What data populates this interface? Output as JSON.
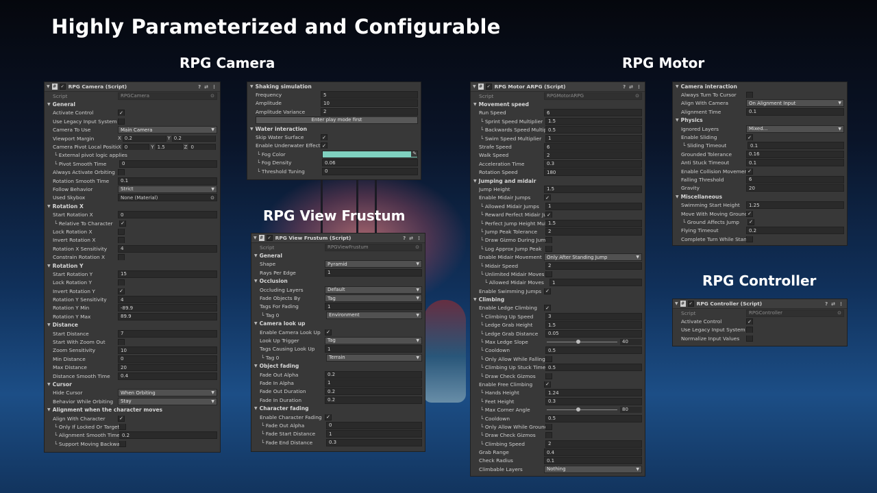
{
  "headline": "Highly Parameterized and Configurable",
  "section_titles": {
    "camera": "RPG Camera",
    "motor": "RPG Motor",
    "frustum": "RPG View Frustum",
    "controller": "RPG Controller"
  },
  "header_icons": [
    "help-icon",
    "settings-icon",
    "more-icon"
  ],
  "colors": {
    "panel": "#383838",
    "field": "#2a2a2a",
    "fog_color": "#7fd0bf"
  },
  "camera_panel": {
    "header": "RPG Camera (Script)",
    "rows": [
      {
        "t": "script",
        "label": "Script",
        "value": "RPGCamera"
      },
      {
        "t": "group",
        "label": "General"
      },
      {
        "t": "check",
        "label": "Activate Control",
        "value": true
      },
      {
        "t": "check",
        "label": "Use Legacy Input System",
        "value": false
      },
      {
        "t": "dropdown",
        "label": "Camera To Use",
        "value": "Main Camera"
      },
      {
        "t": "vec",
        "label": "Viewport Margin",
        "axes": [
          "X",
          "Y"
        ],
        "values": [
          "0.2",
          "0.2"
        ]
      },
      {
        "t": "vec",
        "label": "Camera Pivot Local Position",
        "axes": [
          "X",
          "Y",
          "Z"
        ],
        "values": [
          "0",
          "1.5",
          "0"
        ]
      },
      {
        "t": "note",
        "label": "└ External pivot logic applies"
      },
      {
        "t": "field",
        "label": "Pivot Smooth Time",
        "value": "0",
        "sub": 1
      },
      {
        "t": "check",
        "label": "Always Activate Orbiting",
        "value": false
      },
      {
        "t": "field",
        "label": "Rotation Smooth Time",
        "value": "0.1"
      },
      {
        "t": "dropdown",
        "label": "Follow Behavior",
        "value": "Strict"
      },
      {
        "t": "object",
        "label": "Used Skybox",
        "value": "None (Material)"
      },
      {
        "t": "group",
        "label": "Rotation X"
      },
      {
        "t": "field",
        "label": "Start Rotation X",
        "value": "0"
      },
      {
        "t": "check",
        "label": "Relative To Character",
        "value": true,
        "sub": 1
      },
      {
        "t": "check",
        "label": "Lock Rotation X",
        "value": false
      },
      {
        "t": "check",
        "label": "Invert Rotation X",
        "value": false
      },
      {
        "t": "field",
        "label": "Rotation X Sensitivity",
        "value": "4"
      },
      {
        "t": "check",
        "label": "Constrain Rotation X",
        "value": false
      },
      {
        "t": "group",
        "label": "Rotation Y"
      },
      {
        "t": "field",
        "label": "Start Rotation Y",
        "value": "15"
      },
      {
        "t": "check",
        "label": "Lock Rotation Y",
        "value": false
      },
      {
        "t": "check",
        "label": "Invert Rotation Y",
        "value": true
      },
      {
        "t": "field",
        "label": "Rotation Y Sensitivity",
        "value": "4"
      },
      {
        "t": "field",
        "label": "Rotation Y Min",
        "value": "-89.9"
      },
      {
        "t": "field",
        "label": "Rotation Y Max",
        "value": "89.9"
      },
      {
        "t": "group",
        "label": "Distance"
      },
      {
        "t": "field",
        "label": "Start Distance",
        "value": "7"
      },
      {
        "t": "check",
        "label": "Start With Zoom Out",
        "value": false
      },
      {
        "t": "field",
        "label": "Zoom Sensitivity",
        "value": "10"
      },
      {
        "t": "field",
        "label": "Min Distance",
        "value": "0"
      },
      {
        "t": "field",
        "label": "Max Distance",
        "value": "20"
      },
      {
        "t": "field",
        "label": "Distance Smooth Time",
        "value": "0.4"
      },
      {
        "t": "group",
        "label": "Cursor"
      },
      {
        "t": "dropdown",
        "label": "Hide Cursor",
        "value": "When Orbiting"
      },
      {
        "t": "dropdown",
        "label": "Behavior While Orbiting",
        "value": "Stay"
      },
      {
        "t": "group",
        "label": "Alignment when the character moves"
      },
      {
        "t": "check",
        "label": "Align With Character",
        "value": true
      },
      {
        "t": "check",
        "label": "Only If Locked Or Targeting",
        "value": false,
        "sub": 1
      },
      {
        "t": "field",
        "label": "Alignment Smooth Time",
        "value": "0.2",
        "sub": 1
      },
      {
        "t": "check",
        "label": "Support Moving Backwards",
        "value": false,
        "sub": 1
      }
    ]
  },
  "shaking_panel": {
    "rows": [
      {
        "t": "group",
        "label": "Shaking simulation"
      },
      {
        "t": "field",
        "label": "Frequency",
        "value": "5"
      },
      {
        "t": "field",
        "label": "Amplitude",
        "value": "10"
      },
      {
        "t": "field",
        "label": "Amplitude Variance",
        "value": "2"
      },
      {
        "t": "button",
        "label": "Enter play mode first"
      },
      {
        "t": "group",
        "label": "Water interaction"
      },
      {
        "t": "check",
        "label": "Skip Water Surface",
        "value": true
      },
      {
        "t": "check",
        "label": "Enable Underwater Effect",
        "value": true
      },
      {
        "t": "color",
        "label": "Fog Color",
        "sub": 1
      },
      {
        "t": "field",
        "label": "Fog Density",
        "value": "0.06",
        "sub": 1
      },
      {
        "t": "field",
        "label": "Threshold Tuning",
        "value": "0",
        "sub": 1
      }
    ]
  },
  "frustum_panel": {
    "header": "RPG View Frustum (Script)",
    "rows": [
      {
        "t": "script",
        "label": "Script",
        "value": "RPGViewFrustum"
      },
      {
        "t": "group",
        "label": "General"
      },
      {
        "t": "dropdown",
        "label": "Shape",
        "value": "Pyramid"
      },
      {
        "t": "field",
        "label": "Rays Per Edge",
        "value": "1"
      },
      {
        "t": "group",
        "label": "Occlusion"
      },
      {
        "t": "dropdown",
        "label": "Occluding Layers",
        "value": "Default"
      },
      {
        "t": "dropdown",
        "label": "Fade Objects By",
        "value": "Tag"
      },
      {
        "t": "field",
        "label": "Tags For Fading",
        "value": "1"
      },
      {
        "t": "dropdown",
        "label": "Tag 0",
        "value": "Environment",
        "sub": 1
      },
      {
        "t": "group",
        "label": "Camera look up"
      },
      {
        "t": "check",
        "label": "Enable Camera Look Up",
        "value": true
      },
      {
        "t": "dropdown",
        "label": "Look Up Trigger",
        "value": "Tag"
      },
      {
        "t": "field",
        "label": "Tags Causing Look Up",
        "value": "1"
      },
      {
        "t": "dropdown",
        "label": "Tag 0",
        "value": "Terrain",
        "sub": 1
      },
      {
        "t": "group",
        "label": "Object fading"
      },
      {
        "t": "field",
        "label": "Fade Out Alpha",
        "value": "0.2"
      },
      {
        "t": "field",
        "label": "Fade In Alpha",
        "value": "1"
      },
      {
        "t": "field",
        "label": "Fade Out Duration",
        "value": "0.2"
      },
      {
        "t": "field",
        "label": "Fade In Duration",
        "value": "0.2"
      },
      {
        "t": "group",
        "label": "Character fading"
      },
      {
        "t": "check",
        "label": "Enable Character Fading",
        "value": true
      },
      {
        "t": "field",
        "label": "Fade Out Alpha",
        "value": "0",
        "sub": 1
      },
      {
        "t": "field",
        "label": "Fade Start Distance",
        "value": "1",
        "sub": 1
      },
      {
        "t": "field",
        "label": "Fade End Distance",
        "value": "0.3",
        "sub": 1
      }
    ]
  },
  "motor_panel": {
    "header": "RPG Motor ARPG (Script)",
    "rows": [
      {
        "t": "script",
        "label": "Script",
        "value": "RPGMotorARPG"
      },
      {
        "t": "group",
        "label": "Movement speed"
      },
      {
        "t": "field",
        "label": "Run Speed",
        "value": "6"
      },
      {
        "t": "field",
        "label": "Sprint Speed Multiplier",
        "value": "1.5",
        "sub": 1
      },
      {
        "t": "field",
        "label": "Backwards Speed Multiplier",
        "value": "0.5",
        "sub": 1
      },
      {
        "t": "field",
        "label": "Swim Speed Multiplier",
        "value": "1",
        "sub": 1
      },
      {
        "t": "field",
        "label": "Strafe Speed",
        "value": "6"
      },
      {
        "t": "field",
        "label": "Walk Speed",
        "value": "2"
      },
      {
        "t": "field",
        "label": "Acceleration Time",
        "value": "0.3"
      },
      {
        "t": "field",
        "label": "Rotation Speed",
        "value": "180"
      },
      {
        "t": "group",
        "label": "Jumping and midair"
      },
      {
        "t": "field",
        "label": "Jump Height",
        "value": "1.5"
      },
      {
        "t": "check",
        "label": "Enable Midair Jumps",
        "value": true
      },
      {
        "t": "field",
        "label": "Allowed Midair Jumps",
        "value": "1",
        "sub": 1
      },
      {
        "t": "check",
        "label": "Reward Perfect Midair Jumps",
        "value": true,
        "sub": 1
      },
      {
        "t": "field",
        "label": "Perfect Jump Height Multiplier",
        "value": "1.5",
        "sub": 1
      },
      {
        "t": "field",
        "label": "Jump Peak Tolerance",
        "value": "2",
        "sub": 1
      },
      {
        "t": "check",
        "label": "Draw Gizmo During Jump",
        "value": false,
        "sub": 1
      },
      {
        "t": "check",
        "label": "Log Approx Jump Peak",
        "value": false,
        "sub": 1
      },
      {
        "t": "dropdown",
        "label": "Enable Midair Movement",
        "value": "Only After Standing Jump"
      },
      {
        "t": "field",
        "label": "Midair Speed",
        "value": "2",
        "sub": 1
      },
      {
        "t": "check",
        "label": "Unlimited Midair Moves",
        "value": false,
        "sub": 1
      },
      {
        "t": "field",
        "label": "Allowed Midair Moves",
        "value": "1",
        "sub": 2
      },
      {
        "t": "check",
        "label": "Enable Swimming Jumps",
        "value": true
      },
      {
        "t": "group",
        "label": "Climbing"
      },
      {
        "t": "check",
        "label": "Enable Ledge Climbing",
        "value": true
      },
      {
        "t": "field",
        "label": "Climbing Up Speed",
        "value": "3",
        "sub": 1
      },
      {
        "t": "field",
        "label": "Ledge Grab Height",
        "value": "1.5",
        "sub": 1
      },
      {
        "t": "field",
        "label": "Ledge Grab Distance",
        "value": "0.05",
        "sub": 1
      },
      {
        "t": "slider",
        "label": "Max Ledge Slope",
        "value": "40",
        "fraction": 0.44,
        "sub": 1
      },
      {
        "t": "field",
        "label": "Cooldown",
        "value": "0.5",
        "sub": 1
      },
      {
        "t": "check",
        "label": "Only Allow While Falling",
        "value": false,
        "sub": 1
      },
      {
        "t": "field",
        "label": "Climbing Up Stuck Time",
        "value": "0.5",
        "sub": 1
      },
      {
        "t": "check",
        "label": "Draw Check Gizmos",
        "value": false,
        "sub": 1
      },
      {
        "t": "check",
        "label": "Enable Free Climbing",
        "value": true
      },
      {
        "t": "field",
        "label": "Hands Height",
        "value": "1.24",
        "sub": 1
      },
      {
        "t": "field",
        "label": "Feet Height",
        "value": "0.3",
        "sub": 1
      },
      {
        "t": "slider",
        "label": "Max Corner Angle",
        "value": "80",
        "fraction": 0.44,
        "sub": 1
      },
      {
        "t": "field",
        "label": "Cooldown",
        "value": "0.5",
        "sub": 1
      },
      {
        "t": "check",
        "label": "Only Allow While Grounded",
        "value": false,
        "sub": 1
      },
      {
        "t": "check",
        "label": "Draw Check Gizmos",
        "value": false,
        "sub": 1
      },
      {
        "t": "field",
        "label": "Climbing Speed",
        "value": "2",
        "sub": 1
      },
      {
        "t": "field",
        "label": "Grab Range",
        "value": "0.4"
      },
      {
        "t": "field",
        "label": "Check Radius",
        "value": "0.1"
      },
      {
        "t": "dropdown",
        "label": "Climbable Layers",
        "value": "Nothing"
      }
    ]
  },
  "motor_panel_2": {
    "rows": [
      {
        "t": "group",
        "label": "Camera interaction"
      },
      {
        "t": "check",
        "label": "Always Turn To Cursor",
        "value": false
      },
      {
        "t": "dropdown",
        "label": "Align With Camera",
        "value": "On Alignment Input"
      },
      {
        "t": "field",
        "label": "Alignment Time",
        "value": "0.1"
      },
      {
        "t": "group",
        "label": "Physics"
      },
      {
        "t": "dropdown",
        "label": "Ignored Layers",
        "value": "Mixed..."
      },
      {
        "t": "check",
        "label": "Enable Sliding",
        "value": true
      },
      {
        "t": "field",
        "label": "Sliding Timeout",
        "value": "0.1",
        "sub": 1
      },
      {
        "t": "field",
        "label": "Grounded Tolerance",
        "value": "0.16"
      },
      {
        "t": "field",
        "label": "Anti Stuck Timeout",
        "value": "0.1"
      },
      {
        "t": "check",
        "label": "Enable Collision Movement",
        "value": true
      },
      {
        "t": "field",
        "label": "Falling Threshold",
        "value": "6"
      },
      {
        "t": "field",
        "label": "Gravity",
        "value": "20"
      },
      {
        "t": "group",
        "label": "Miscellaneous"
      },
      {
        "t": "field",
        "label": "Swimming Start Height",
        "value": "1.25"
      },
      {
        "t": "check",
        "label": "Move With Moving Ground",
        "value": true
      },
      {
        "t": "check",
        "label": "Ground Affects Jump",
        "value": true,
        "sub": 1
      },
      {
        "t": "field",
        "label": "Flying Timeout",
        "value": "0.2"
      },
      {
        "t": "check",
        "label": "Complete Turn While Standing",
        "value": false
      }
    ]
  },
  "controller_panel": {
    "header": "RPG Controller (Script)",
    "rows": [
      {
        "t": "script",
        "label": "Script",
        "value": "RPGController"
      },
      {
        "t": "check",
        "label": "Activate Control",
        "value": true
      },
      {
        "t": "check",
        "label": "Use Legacy Input System",
        "value": false
      },
      {
        "t": "check",
        "label": "Normalize Input Values",
        "value": false
      }
    ]
  }
}
